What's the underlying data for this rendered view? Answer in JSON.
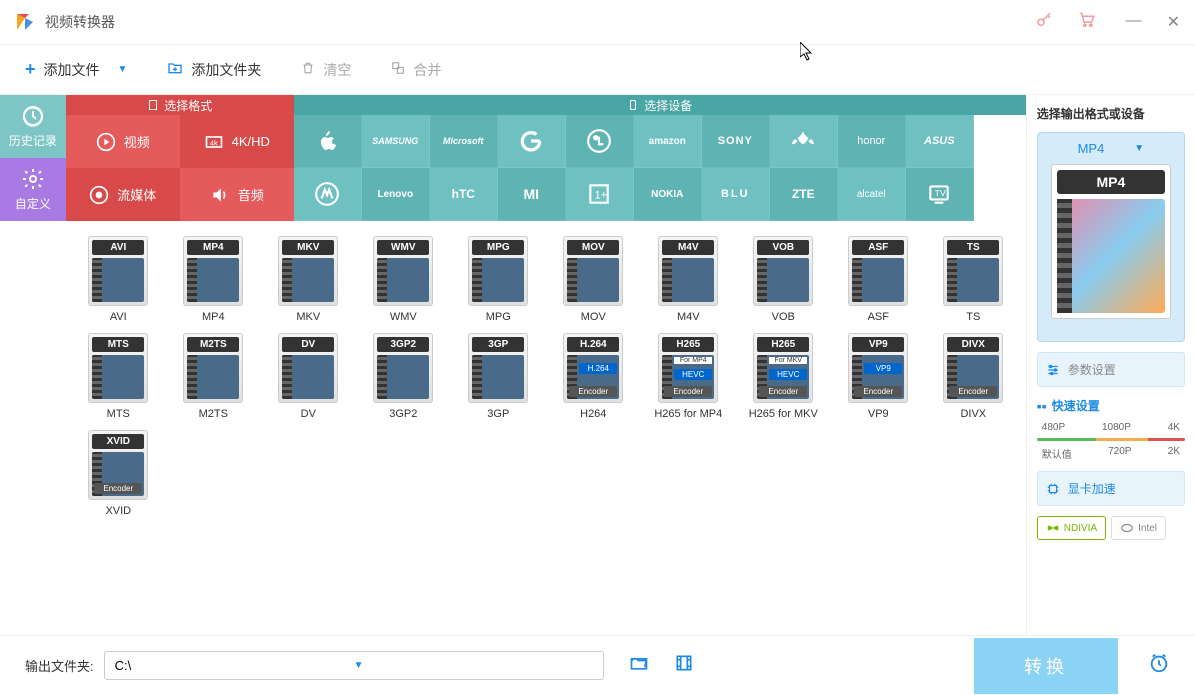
{
  "window": {
    "title": "视频转换器"
  },
  "toolbar": {
    "add_file": "添加文件",
    "add_folder": "添加文件夹",
    "clear": "清空",
    "merge": "合并"
  },
  "sidebar": {
    "history": "历史记录",
    "custom": "自定义"
  },
  "categories": {
    "format": "选择格式",
    "device": "选择设备"
  },
  "tabs": {
    "video": "视频",
    "fourk": "4K/HD",
    "stream": "流媒体",
    "audio": "音频"
  },
  "brands": {
    "row1": [
      "Apple",
      "SAMSUNG",
      "Microsoft",
      "Google",
      "LG",
      "amazon",
      "SONY",
      "HUAWEI",
      "honor",
      "ASUS"
    ],
    "row2": [
      "Motorola",
      "Lenovo",
      "hTC",
      "MI",
      "OnePlus",
      "NOKIA",
      "BLU",
      "ZTE",
      "alcatel",
      "TV"
    ]
  },
  "formats": [
    {
      "badge": "AVI",
      "label": "AVI"
    },
    {
      "badge": "MP4",
      "label": "MP4"
    },
    {
      "badge": "MKV",
      "label": "MKV"
    },
    {
      "badge": "WMV",
      "label": "WMV"
    },
    {
      "badge": "MPG",
      "label": "MPG"
    },
    {
      "badge": "MOV",
      "label": "MOV"
    },
    {
      "badge": "M4V",
      "label": "M4V"
    },
    {
      "badge": "VOB",
      "label": "VOB"
    },
    {
      "badge": "ASF",
      "label": "ASF"
    },
    {
      "badge": "TS",
      "label": "TS"
    },
    {
      "badge": "MTS",
      "label": "MTS"
    },
    {
      "badge": "M2TS",
      "label": "M2TS"
    },
    {
      "badge": "DV",
      "label": "DV"
    },
    {
      "badge": "3GP2",
      "label": "3GP2"
    },
    {
      "badge": "3GP",
      "label": "3GP"
    },
    {
      "badge": "H.264",
      "label": "H264",
      "encoder": "Encoder",
      "sub": "H.264"
    },
    {
      "badge": "H265",
      "label": "H265 for MP4",
      "encoder": "Encoder",
      "sub": "HEVC",
      "note": "For MP4"
    },
    {
      "badge": "H265",
      "label": "H265 for MKV",
      "encoder": "Encoder",
      "sub": "HEVC",
      "note": "For MKV"
    },
    {
      "badge": "VP9",
      "label": "VP9",
      "encoder": "Encoder",
      "sub": "VP9"
    },
    {
      "badge": "DIVX",
      "label": "DIVX",
      "encoder": "Encoder"
    },
    {
      "badge": "XVID",
      "label": "XVID",
      "encoder": "Encoder"
    }
  ],
  "right_panel": {
    "title": "选择输出格式或设备",
    "selected": "MP4",
    "preview_badge": "MP4",
    "params": "参数设置",
    "quick_title": "快速设置",
    "res_top": [
      "480P",
      "1080P",
      "4K"
    ],
    "res_bottom": [
      "默认值",
      "720P",
      "2K"
    ],
    "gpu": "显卡加速",
    "nvidia": "NDIVIA",
    "intel": "Intel"
  },
  "bottom": {
    "output_label": "输出文件夹:",
    "output_path": "C:\\",
    "convert": "转换"
  }
}
